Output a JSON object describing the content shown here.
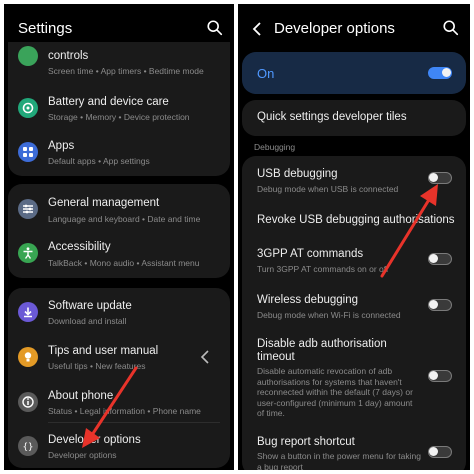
{
  "left": {
    "title": "Settings",
    "items": [
      {
        "title": "controls",
        "subtitle": "Screen time  •  App timers  •  Bedtime mode"
      },
      {
        "title": "Battery and device care",
        "subtitle": "Storage  •  Memory  •  Device protection"
      },
      {
        "title": "Apps",
        "subtitle": "Default apps  •  App settings"
      },
      {
        "title": "General management",
        "subtitle": "Language and keyboard  •  Date and time"
      },
      {
        "title": "Accessibility",
        "subtitle": "TalkBack  •  Mono audio  •  Assistant menu"
      },
      {
        "title": "Software update",
        "subtitle": "Download and install"
      },
      {
        "title": "Tips and user manual",
        "subtitle": "Useful tips  •  New features"
      },
      {
        "title": "About phone",
        "subtitle": "Status  •  Legal information  •  Phone name"
      },
      {
        "title": "Developer options",
        "subtitle": "Developer options"
      }
    ]
  },
  "right": {
    "title": "Developer options",
    "master": {
      "label": "On",
      "enabled": true
    },
    "quick_tiles": "Quick settings developer tiles",
    "section": "Debugging",
    "items": [
      {
        "title": "USB debugging",
        "subtitle": "Debug mode when USB is connected",
        "toggle": false
      },
      {
        "title": "Revoke USB debugging authorisations"
      },
      {
        "title": "3GPP AT commands",
        "subtitle": "Turn 3GPP AT commands on or off",
        "toggle": false
      },
      {
        "title": "Wireless debugging",
        "subtitle": "Debug mode when Wi-Fi is connected",
        "toggle": false
      },
      {
        "title": "Disable adb authorisation timeout",
        "subtitle": "Disable automatic revocation of adb authorisations for systems that haven't reconnected within the default (7 days) or user-configured (minimum 1 day) amount of time.",
        "toggle": false
      },
      {
        "title": "Bug report shortcut",
        "subtitle": "Show a button in the power menu for taking a bug report",
        "toggle": false
      }
    ]
  },
  "colors": {
    "accent_blue": "#3f86f6",
    "arrow_red": "#e8332a",
    "background": "#000000",
    "card": "#1a1a1a"
  },
  "icons": [
    "search-icon",
    "back-arrow-icon",
    "chevron-left-icon",
    "battery-care-icon",
    "apps-icon",
    "general-management-icon",
    "accessibility-icon",
    "software-update-icon",
    "tips-icon",
    "about-phone-icon",
    "developer-options-icon"
  ]
}
